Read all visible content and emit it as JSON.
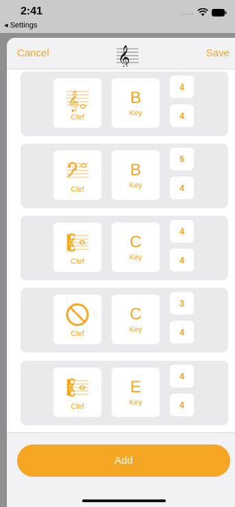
{
  "statusbar": {
    "time": "2:41",
    "back_app": "◂ Settings",
    "signal_dots": "....."
  },
  "nav": {
    "cancel": "Cancel",
    "save": "Save",
    "logo_icon": "treble-clef-staff-icon"
  },
  "accent": "#f5a623",
  "cards": [
    {
      "clef_icon": "treble-clef-icon",
      "clef_label": "Clef",
      "key": "B",
      "key_label": "Key",
      "top_num": "4",
      "bottom_num": "4"
    },
    {
      "clef_icon": "bass-clef-icon",
      "clef_label": "Clef",
      "key": "B",
      "key_label": "Key",
      "top_num": "5",
      "bottom_num": "4"
    },
    {
      "clef_icon": "alto-clef-icon",
      "clef_label": "Clef",
      "key": "C",
      "key_label": "Key",
      "top_num": "4",
      "bottom_num": "4"
    },
    {
      "clef_icon": "no-clef-icon",
      "clef_label": "Clef",
      "key": "C",
      "key_label": "Key",
      "top_num": "3",
      "bottom_num": "4"
    },
    {
      "clef_icon": "alto-clef-icon",
      "clef_label": "Clef",
      "key": "E",
      "key_label": "Key",
      "top_num": "4",
      "bottom_num": "4"
    }
  ],
  "add_button": "Add"
}
